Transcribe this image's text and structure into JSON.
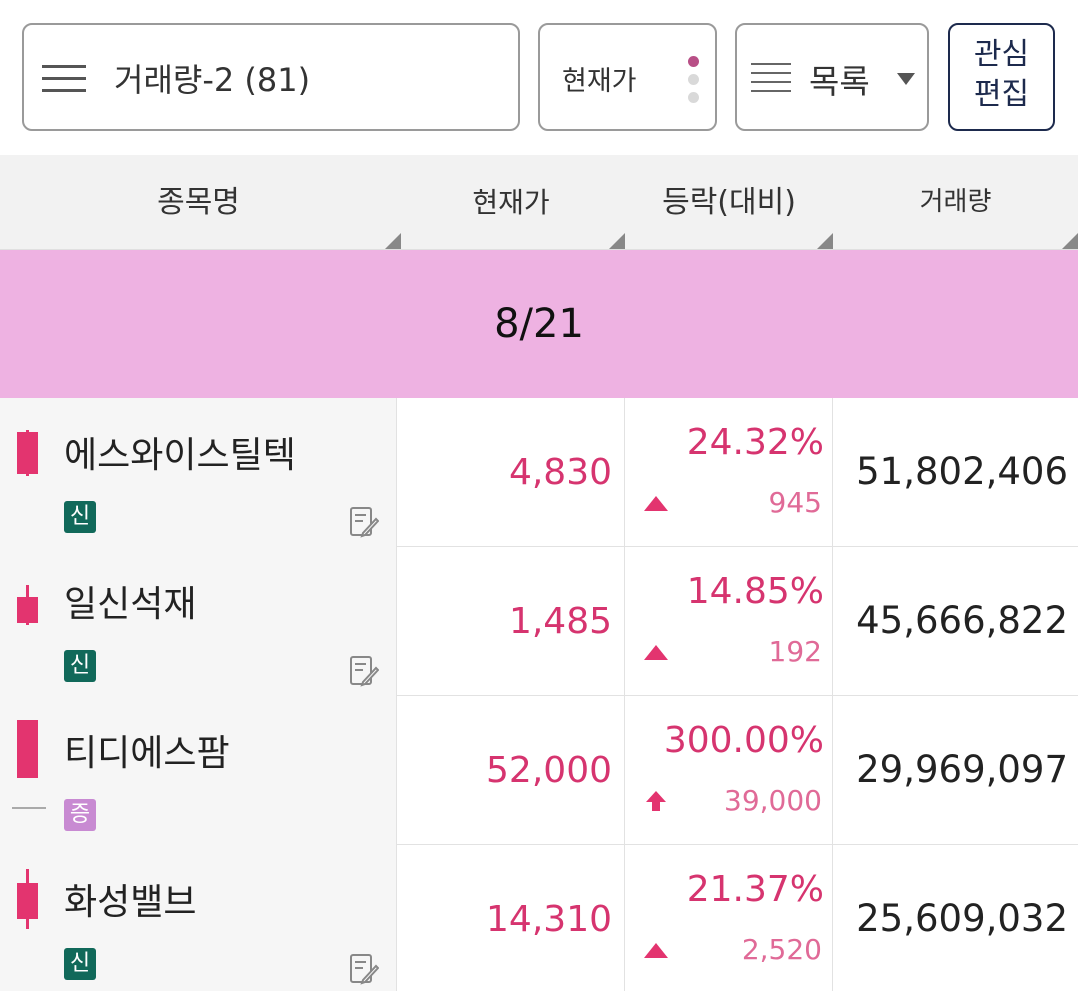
{
  "toolbar": {
    "group_label": "거래량-2 (81)",
    "price_button_label": "현재가",
    "list_label": "목록",
    "edit_label": "관심\n편집"
  },
  "table_header": {
    "name": "종목명",
    "price": "현재가",
    "change": "등락(대비)",
    "volume": "거래량"
  },
  "date_banner": "8/21",
  "colors": {
    "rise": "#d6346f",
    "new_badge": "#11695a",
    "increase_badge": "#c88ad2",
    "banner": "#eeb2e2",
    "edit_border": "#1d2a4d"
  },
  "rows": [
    {
      "name": "에스와이스틸텍",
      "badge": "신",
      "price": "4,830",
      "rate": "24.32%",
      "diff": "945",
      "volume": "51,802,406",
      "has_memo": true,
      "indicator": "rise-triangle-icon"
    },
    {
      "name": "일신석재",
      "badge": "신",
      "price": "1,485",
      "rate": "14.85%",
      "diff": "192",
      "volume": "45,666,822",
      "has_memo": true,
      "indicator": "rise-triangle-icon"
    },
    {
      "name": "티디에스팜",
      "badge": "증",
      "price": "52,000",
      "rate": "300.00%",
      "diff": "39,000",
      "volume": "29,969,097",
      "has_memo": false,
      "indicator": "upper-limit-arrow-icon"
    },
    {
      "name": "화성밸브",
      "badge": "신",
      "price": "14,310",
      "rate": "21.37%",
      "diff": "2,520",
      "volume": "25,609,032",
      "has_memo": true,
      "indicator": "rise-triangle-icon"
    }
  ]
}
